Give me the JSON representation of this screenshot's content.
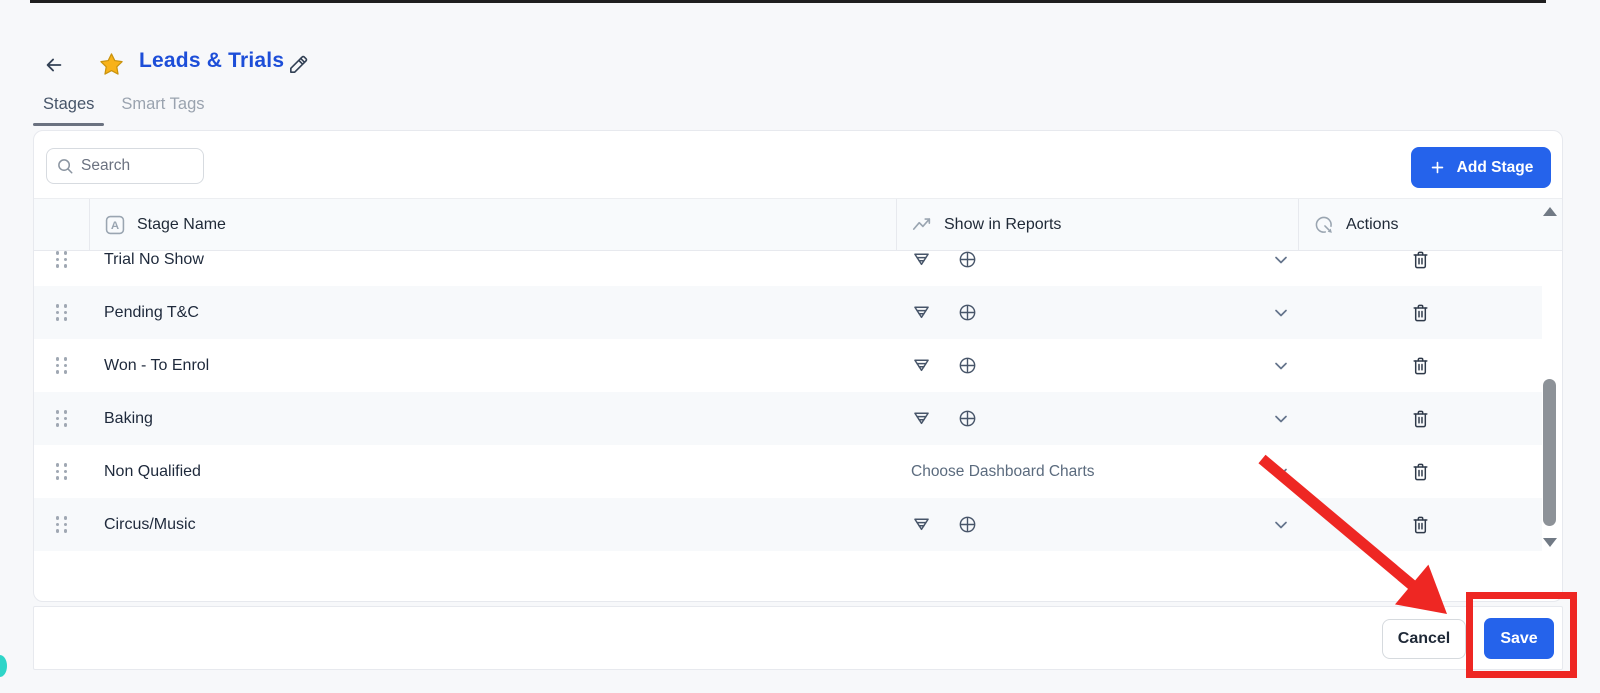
{
  "header": {
    "title": "Leads & Trials"
  },
  "tabs": {
    "stages": "Stages",
    "smart_tags": "Smart Tags"
  },
  "toolbar": {
    "search_placeholder": "Search",
    "add_stage": "Add Stage"
  },
  "table": {
    "columns": {
      "stage_name": "Stage Name",
      "show_in_reports": "Show in Reports",
      "actions": "Actions"
    },
    "rows": [
      {
        "name": "Trial No Show"
      },
      {
        "name": "Pending T&C"
      },
      {
        "name": "Won - To Enrol"
      },
      {
        "name": "Baking"
      },
      {
        "name": "Non Qualified",
        "reports_placeholder": "Choose Dashboard Charts"
      },
      {
        "name": "Circus/Music"
      }
    ]
  },
  "footer": {
    "cancel": "Cancel",
    "save": "Save"
  },
  "icons": {
    "back": "arrow-left",
    "favorite": "star",
    "edit": "pencil",
    "search": "magnifier",
    "add": "plus",
    "stage_name_column": "letter-a-box",
    "show_in_reports_column": "trend-line",
    "actions_column": "cursor-click",
    "report_funnel": "funnel-chart",
    "report_pie": "pie-chart",
    "expand": "chevron-down",
    "delete": "trash",
    "drag": "drag-dots"
  },
  "colors": {
    "accent_blue": "#2563eb",
    "title_blue": "#1d4ed8",
    "highlight_red": "#ee2723",
    "star_yellow": "#f8b219",
    "chat_teal": "#2fd5c8",
    "row_alt": "#f7f9fb",
    "header_bg": "#f8fafc",
    "page_bg": "#f7f8fa",
    "border": "#e7e9ee",
    "text_dark": "#1e293b",
    "text_gray": "#64748b"
  }
}
